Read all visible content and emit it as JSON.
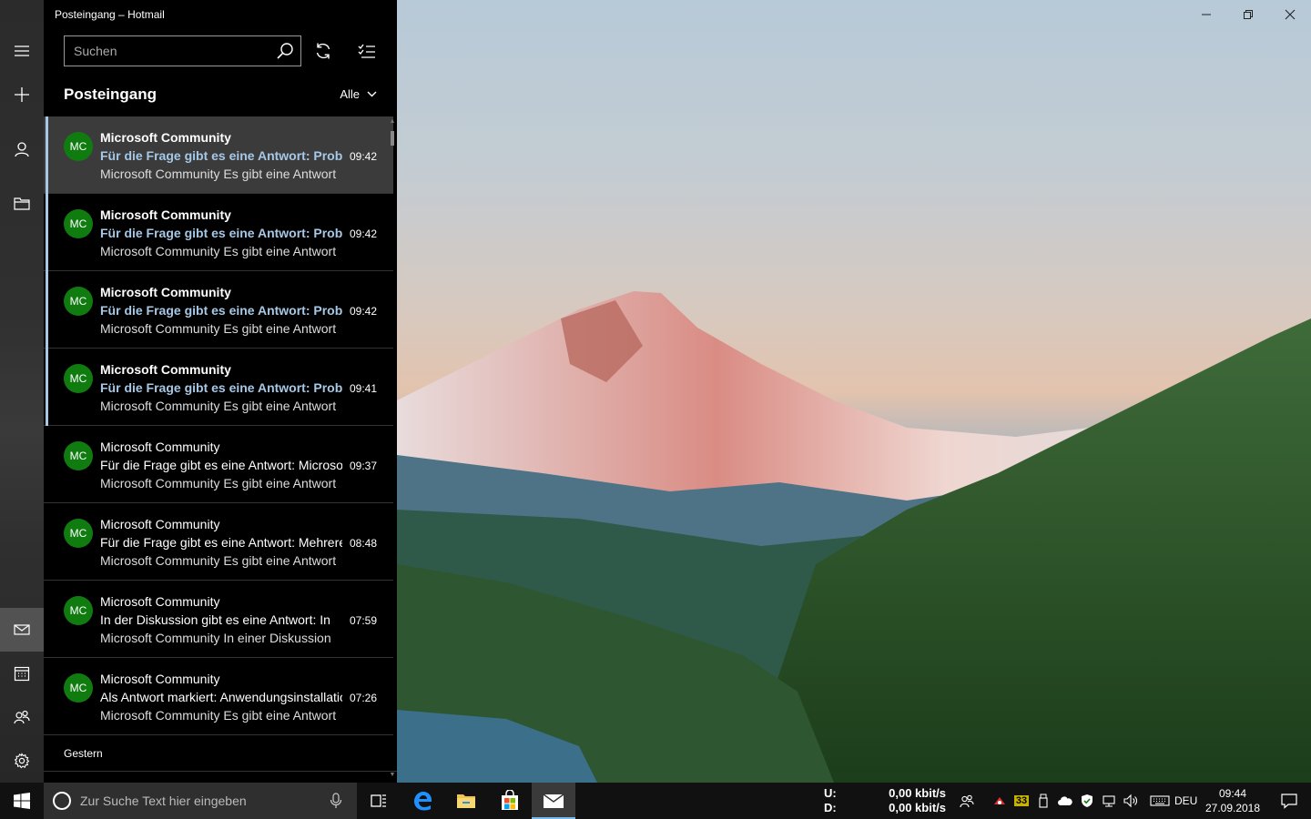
{
  "window": {
    "title": "Posteingang – Hotmail",
    "controls": [
      "minimize-icon",
      "restore-icon",
      "close-icon"
    ]
  },
  "rail": {
    "items": [
      {
        "name": "hamburger-menu",
        "icon": "hamburger-icon"
      },
      {
        "name": "new-mail",
        "icon": "plus-icon"
      },
      {
        "name": "accounts",
        "icon": "person-icon"
      },
      {
        "name": "folders",
        "icon": "folder-icon"
      },
      {
        "name": "mail",
        "icon": "mail-icon",
        "active": true
      },
      {
        "name": "calendar",
        "icon": "calendar-icon"
      },
      {
        "name": "people",
        "icon": "people-icon"
      },
      {
        "name": "settings",
        "icon": "gear-icon"
      }
    ]
  },
  "search": {
    "placeholder": "Suchen"
  },
  "toolbar": {
    "sync": "sync-icon",
    "select": "selection-mode-icon"
  },
  "folder": {
    "title": "Posteingang",
    "filter": "Alle"
  },
  "messages": [
    {
      "initials": "MC",
      "sender": "Microsoft Community",
      "subject": "Für die Frage gibt es eine Antwort: Problem",
      "preview": "Microsoft Community Es gibt eine Antwort",
      "time": "09:42",
      "unread": true,
      "selected": true
    },
    {
      "initials": "MC",
      "sender": "Microsoft Community",
      "subject": "Für die Frage gibt es eine Antwort: Problem",
      "preview": "Microsoft Community Es gibt eine Antwort",
      "time": "09:42",
      "unread": true
    },
    {
      "initials": "MC",
      "sender": "Microsoft Community",
      "subject": "Für die Frage gibt es eine Antwort: Problem",
      "preview": "Microsoft Community Es gibt eine Antwort",
      "time": "09:42",
      "unread": true
    },
    {
      "initials": "MC",
      "sender": "Microsoft Community",
      "subject": "Für die Frage gibt es eine Antwort: Problem",
      "preview": "Microsoft Community Es gibt eine Antwort",
      "time": "09:41",
      "unread": true
    },
    {
      "initials": "MC",
      "sender": "Microsoft Community",
      "subject": "Für die Frage gibt es eine Antwort: Microsoft",
      "preview": "Microsoft Community Es gibt eine Antwort",
      "time": "09:37"
    },
    {
      "initials": "MC",
      "sender": "Microsoft Community",
      "subject": "Für die Frage gibt es eine Antwort: Mehrere",
      "preview": "Microsoft Community Es gibt eine Antwort",
      "time": "08:48"
    },
    {
      "initials": "MC",
      "sender": "Microsoft Community",
      "subject": "In der Diskussion gibt es eine Antwort: In",
      "preview": "Microsoft Community In einer Diskussion",
      "time": "07:59"
    },
    {
      "initials": "MC",
      "sender": "Microsoft Community",
      "subject": "Als Antwort markiert: Anwendungsinstallation",
      "preview": "Microsoft Community Es gibt eine Antwort",
      "time": "07:26"
    }
  ],
  "group_header": "Gestern",
  "taskbar": {
    "search_placeholder": "Zur Suche Text hier eingeben",
    "apps": [
      "task-view-icon",
      "edge-icon",
      "file-explorer-icon",
      "store-icon",
      "mail-app-icon"
    ],
    "net_up_label": "U:",
    "net_up_value": "0,00 kbit/s",
    "net_down_label": "D:",
    "net_down_value": "0,00 kbit/s",
    "tray_badge": "33",
    "language": "DEU",
    "time": "09:44",
    "date": "27.09.2018"
  },
  "colors": {
    "accent": "#76b9ed",
    "unread_bar": "#a6c8e6",
    "avatar": "#107c10"
  }
}
